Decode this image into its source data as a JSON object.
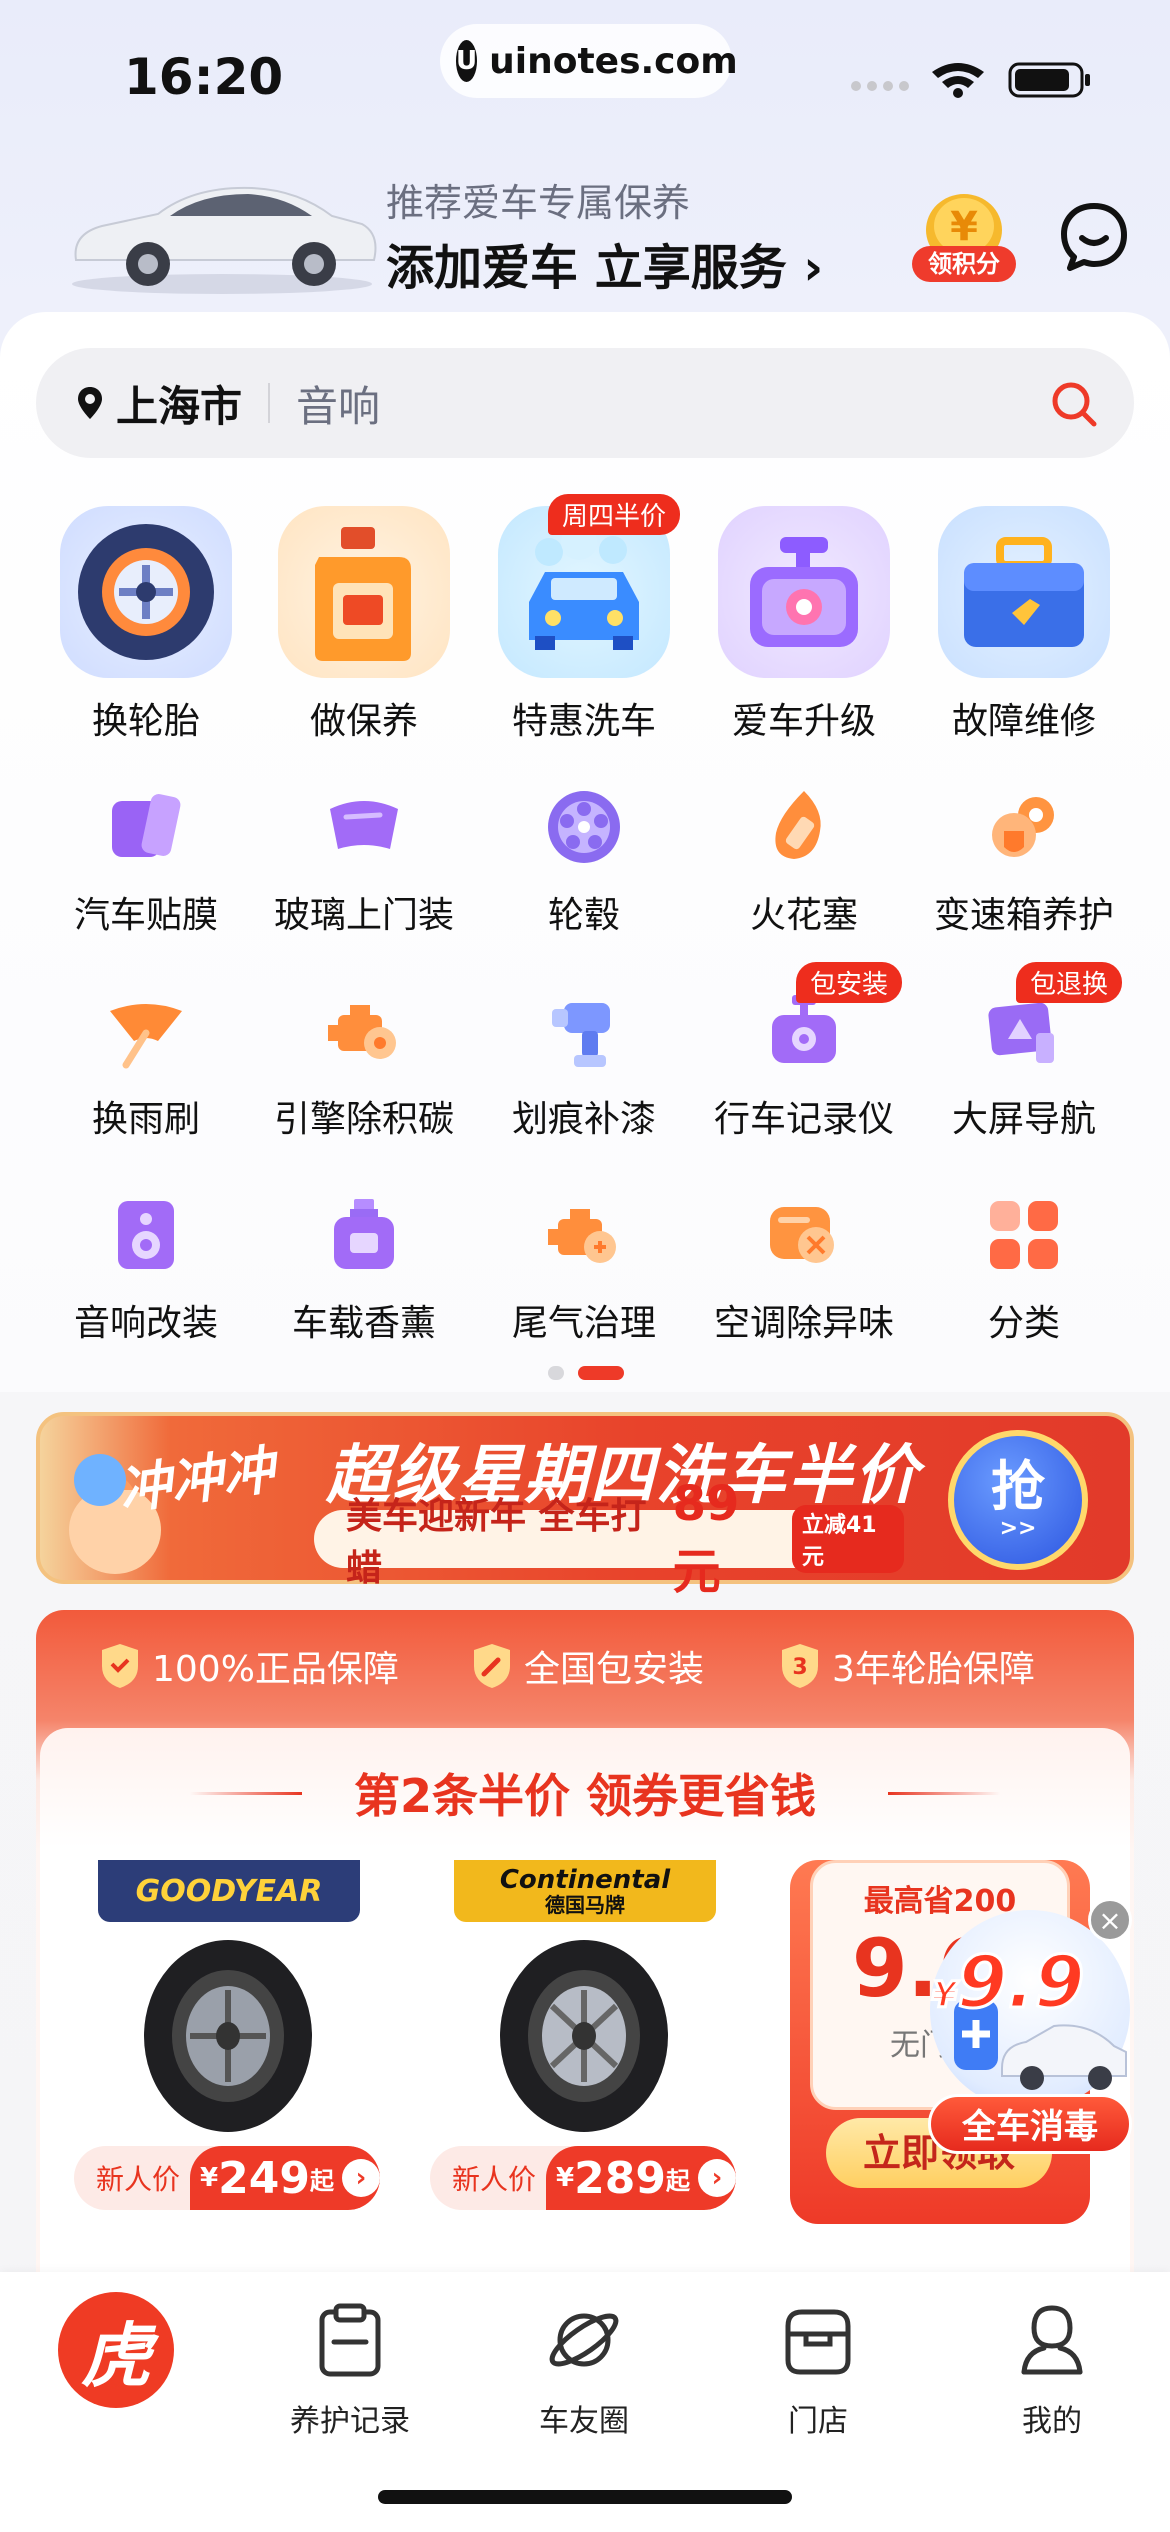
{
  "status_bar": {
    "time": "16:20",
    "url": "uinotes.com"
  },
  "header": {
    "subtitle": "推荐爱车专属保养",
    "title": "添加爱车  立享服务 ›",
    "points_label": "领积分",
    "coin_symbol": "¥"
  },
  "search": {
    "city": "上海市",
    "placeholder": "音响"
  },
  "main_services": [
    {
      "label": "换轮胎",
      "icon": "tire-icon"
    },
    {
      "label": "做保养",
      "icon": "engine-oil-icon"
    },
    {
      "label": "特惠洗车",
      "icon": "car-wash-icon",
      "badge": "周四半价"
    },
    {
      "label": "爱车升级",
      "icon": "dashcam-upgrade-icon"
    },
    {
      "label": "故障维修",
      "icon": "toolbox-icon"
    }
  ],
  "services": [
    {
      "label": "汽车贴膜",
      "icon": "film-icon"
    },
    {
      "label": "玻璃上门装",
      "icon": "windshield-icon"
    },
    {
      "label": "轮毂",
      "icon": "wheel-hub-icon"
    },
    {
      "label": "火花塞",
      "icon": "spark-plug-icon"
    },
    {
      "label": "变速箱养护",
      "icon": "gearbox-icon"
    },
    {
      "label": "换雨刷",
      "icon": "wiper-icon"
    },
    {
      "label": "引擎除积碳",
      "icon": "engine-clean-icon"
    },
    {
      "label": "划痕补漆",
      "icon": "paint-gun-icon"
    },
    {
      "label": "行车记录仪",
      "icon": "dashcam-icon",
      "badge": "包安装"
    },
    {
      "label": "大屏导航",
      "icon": "navigation-screen-icon",
      "badge": "包退换"
    },
    {
      "label": "音响改装",
      "icon": "speaker-icon"
    },
    {
      "label": "车载香薰",
      "icon": "perfume-icon"
    },
    {
      "label": "尾气治理",
      "icon": "exhaust-icon"
    },
    {
      "label": "空调除异味",
      "icon": "ac-deodorize-icon"
    },
    {
      "label": "分类",
      "icon": "category-icon"
    }
  ],
  "banner": {
    "tag": "冲冲冲",
    "title": "超级星期四洗车半价",
    "sub_text": "美车迎新年 全车打蜡",
    "price": "89元",
    "save": "立减41元",
    "button": "抢",
    "button_arrow": ">>"
  },
  "guarantees": [
    "100%正品保障",
    "全国包安装",
    "3年轮胎保障"
  ],
  "tire_section": {
    "title": "第2条半价  领券更省钱",
    "products": [
      {
        "brand": "GOODYEAR",
        "brand_sub": "",
        "tag": "新人价",
        "currency": "¥",
        "price": "249",
        "suffix": "起"
      },
      {
        "brand": "Continental",
        "brand_sub": "德国马牌",
        "tag": "新人价",
        "currency": "¥",
        "price": "289",
        "suffix": "起"
      }
    ],
    "coupon": {
      "top": "最高省200",
      "value": "9.6",
      "condition": "无门槛",
      "button": "立即领取"
    }
  },
  "floating_promo": {
    "currency": "¥",
    "price": "9.9",
    "label": "全车消毒",
    "close": "×"
  },
  "tabbar": {
    "home_icon_text": "虎",
    "tabs": [
      {
        "label": "养护记录",
        "icon": "clipboard-icon"
      },
      {
        "label": "车友圈",
        "icon": "planet-icon"
      },
      {
        "label": "门店",
        "icon": "store-icon"
      },
      {
        "label": "我的",
        "icon": "profile-icon"
      }
    ]
  }
}
